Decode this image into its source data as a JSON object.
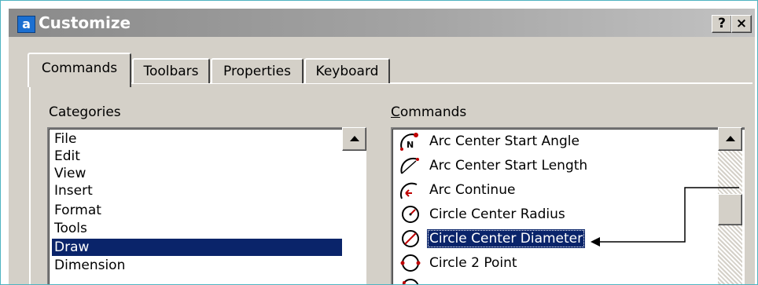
{
  "window": {
    "app_icon_glyph": "a",
    "app_icon_name": "app-icon",
    "title": "Customize",
    "help_label": "?",
    "close_label": "×"
  },
  "tabs": [
    {
      "label": "Commands",
      "active": true
    },
    {
      "label": "Toolbars",
      "active": false
    },
    {
      "label": "Properties",
      "active": false
    },
    {
      "label": "Keyboard",
      "active": false
    }
  ],
  "categories": {
    "label": "Categories",
    "items": [
      {
        "label": "File",
        "selected": false
      },
      {
        "label": "Edit",
        "selected": false
      },
      {
        "label": "View",
        "selected": false
      },
      {
        "label": "Insert",
        "selected": false
      },
      {
        "label": "Format",
        "selected": false
      },
      {
        "label": "Tools",
        "selected": false
      },
      {
        "label": "Draw",
        "selected": true
      },
      {
        "label": "Dimension",
        "selected": false
      }
    ]
  },
  "commands": {
    "label": "Commands",
    "items": [
      {
        "label": "Arc Center Start Angle",
        "icon": "arc-center-start-angle-icon",
        "selected": false
      },
      {
        "label": "Arc Center Start Length",
        "icon": "arc-center-start-length-icon",
        "selected": false
      },
      {
        "label": "Arc Continue",
        "icon": "arc-continue-icon",
        "selected": false
      },
      {
        "label": "Circle Center Radius",
        "icon": "circle-center-radius-icon",
        "selected": false
      },
      {
        "label": "Circle Center Diameter",
        "icon": "circle-center-diameter-icon",
        "selected": true
      },
      {
        "label": "Circle 2 Point",
        "icon": "circle-2-point-icon",
        "selected": false
      },
      {
        "label": "",
        "icon": "circle-3-point-icon",
        "selected": false
      }
    ]
  },
  "colors": {
    "selection": "#0a246a",
    "dialog_face": "#d4d0c8",
    "frame_border": "#4fb3c1",
    "icon_red": "#c00000"
  }
}
